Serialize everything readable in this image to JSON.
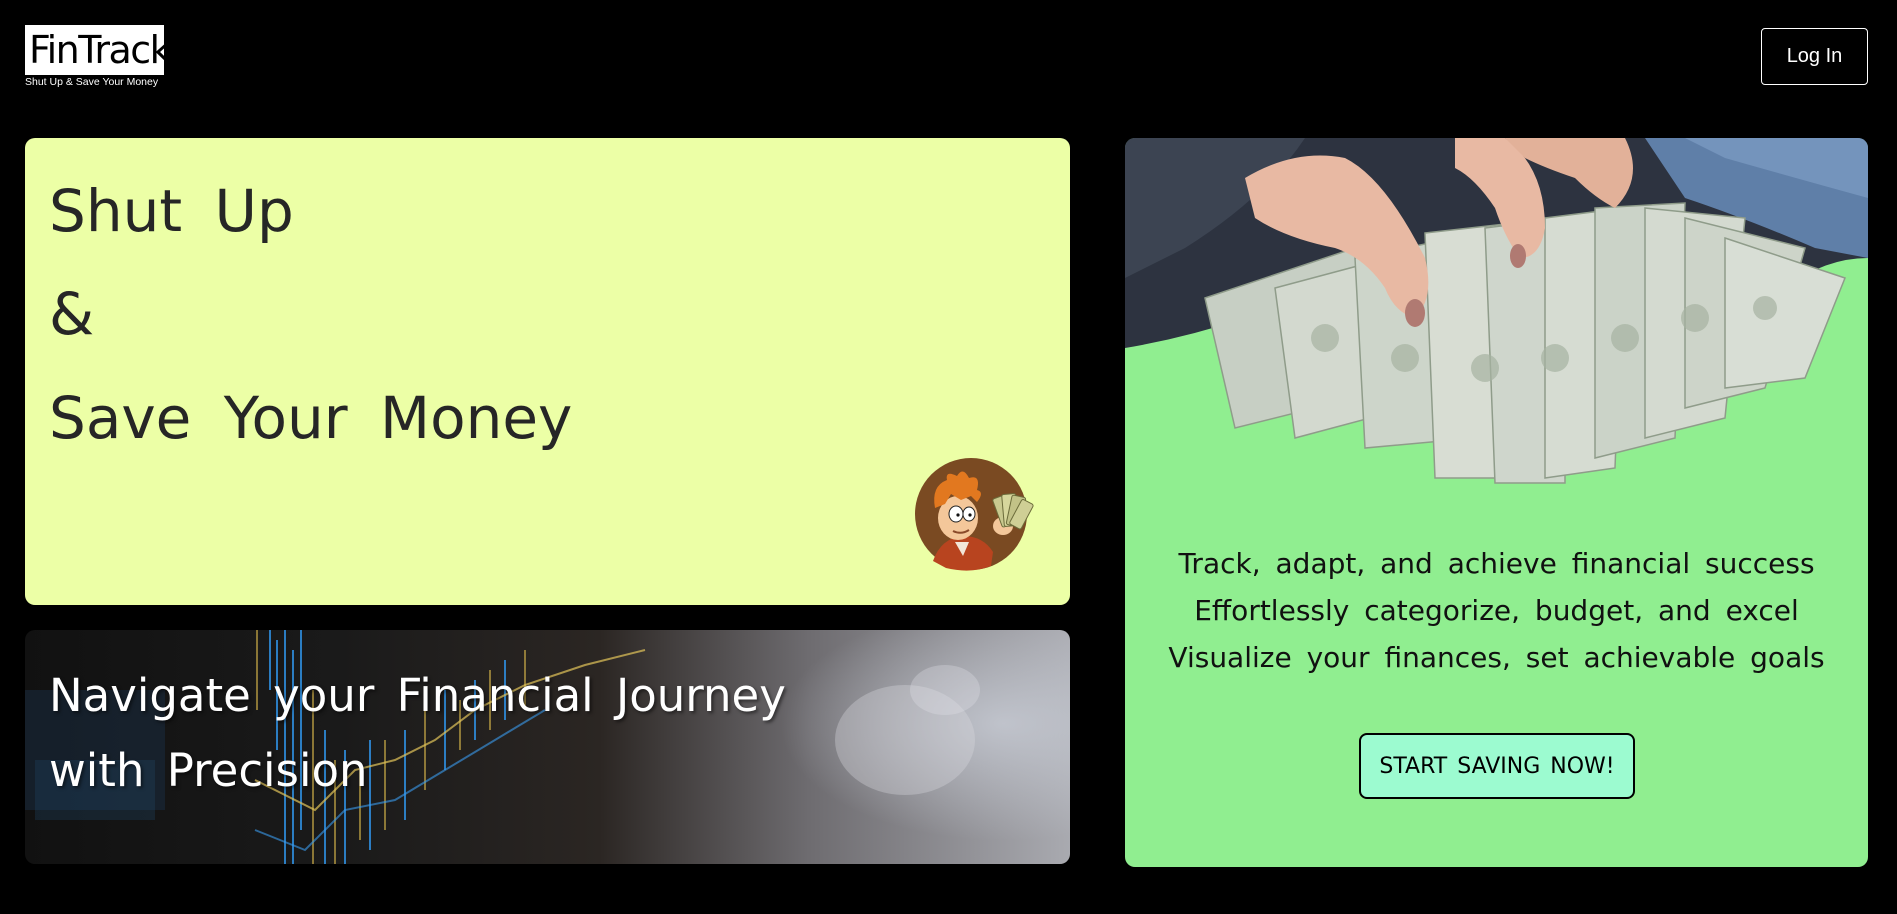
{
  "header": {
    "logo_text": "FinTrack",
    "logo_tagline": "Shut Up & Save Your Money",
    "login_label": "Log In"
  },
  "hero": {
    "line1": "Shut Up",
    "line2": "&",
    "line3": "Save Your Money",
    "mascot_icon": "cartoon-character-holding-money-icon"
  },
  "navigate_card": {
    "line1": "Navigate your Financial Journey",
    "line2": "with Precision"
  },
  "feature_card": {
    "image": "hands-holding-dollar-bills-photo",
    "features": [
      "Track, adapt, and achieve financial success",
      "Effortlessly categorize, budget, and excel",
      "Visualize your finances, set achievable goals"
    ],
    "cta_label": "START SAVING NOW!"
  },
  "colors": {
    "background": "#000000",
    "hero_bg": "#ecffa6",
    "feature_bg": "#90ee90",
    "cta_bg": "#9cfbd0"
  }
}
